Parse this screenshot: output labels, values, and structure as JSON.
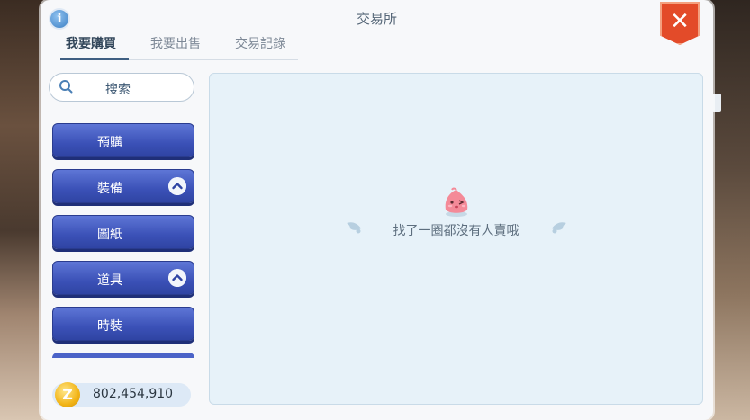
{
  "window": {
    "title": "交易所",
    "close_label": "✕"
  },
  "tabs": [
    {
      "label": "我要購買",
      "active": true
    },
    {
      "label": "我要出售",
      "active": false
    },
    {
      "label": "交易記錄",
      "active": false
    }
  ],
  "search": {
    "label": "搜索"
  },
  "categories": [
    {
      "label": "預購",
      "expandable": false
    },
    {
      "label": "裝備",
      "expandable": true
    },
    {
      "label": "圖紙",
      "expandable": false
    },
    {
      "label": "道具",
      "expandable": true
    },
    {
      "label": "時裝",
      "expandable": false
    }
  ],
  "currency": {
    "icon": "coin-icon",
    "symbol": "Z",
    "amount": "802,454,910"
  },
  "results": {
    "empty_message": "找了一圈都沒有人賣哦"
  },
  "colors": {
    "category_button": "#3b51b7",
    "close_button": "#e34b29",
    "panel_background": "#e7f2f9",
    "active_tab": "#3f5f82"
  }
}
